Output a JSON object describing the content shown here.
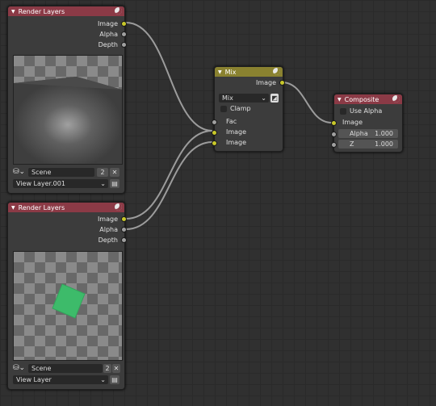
{
  "colors": {
    "render_header": "#8b3a46",
    "mix_header": "#8a8230",
    "socket_color": "#c8c82a",
    "socket_float": "#a0a0a0",
    "wire": "#9c9c9c",
    "green_card": "#3dbb6a"
  },
  "render1": {
    "title": "Render Layers",
    "outputs": [
      "Image",
      "Alpha",
      "Depth"
    ],
    "scene": "Scene",
    "users": "2",
    "view_layer": "View Layer.001"
  },
  "render2": {
    "title": "Render Layers",
    "outputs": [
      "Image",
      "Alpha",
      "Depth"
    ],
    "scene": "Scene",
    "users": "2",
    "view_layer": "View Layer"
  },
  "mix": {
    "title": "Mix",
    "output": "Image",
    "blend_mode": "Mix",
    "clamp_label": "Clamp",
    "inputs": [
      "Fac",
      "Image",
      "Image"
    ]
  },
  "composite": {
    "title": "Composite",
    "use_alpha_label": "Use Alpha",
    "input": "Image",
    "alpha": {
      "label": "Alpha",
      "value": "1.000"
    },
    "z": {
      "label": "Z",
      "value": "1.000"
    }
  },
  "icons": [
    "node-type-icon",
    "scene-icon",
    "collapse-triangle-icon",
    "chevron-down-icon",
    "close-icon",
    "layer-icon"
  ]
}
